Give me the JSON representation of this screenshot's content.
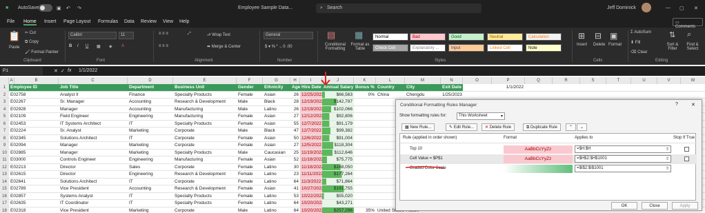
{
  "titlebar": {
    "autosave": "AutoSave",
    "doc": "Employee Sample Data...",
    "search": "Search",
    "user": "Jeff Dominick"
  },
  "menu": [
    "File",
    "Home",
    "Insert",
    "Page Layout",
    "Formulas",
    "Data",
    "Review",
    "View",
    "Help"
  ],
  "comments": "Comments",
  "ribbon": {
    "paste": "Paste",
    "cut": "Cut",
    "copy": "Copy",
    "format_painter": "Format Painter",
    "font": "Calibri",
    "size": "11",
    "wrap": "Wrap Text",
    "merge": "Merge & Center",
    "numfmt": "General",
    "cond": "Conditional Formatting",
    "fmt_table": "Format as Table",
    "styles": [
      {
        "t": "Normal",
        "bg": "#ffffff",
        "fg": "#000000"
      },
      {
        "t": "Bad",
        "bg": "#ffc7ce",
        "fg": "#9c0006"
      },
      {
        "t": "Good",
        "bg": "#c6efce",
        "fg": "#006100"
      },
      {
        "t": "Neutral",
        "bg": "#ffeb9c",
        "fg": "#9c5700"
      },
      {
        "t": "Calculation",
        "bg": "#f2f2f2",
        "fg": "#fa7d00"
      },
      {
        "t": "Check Cell",
        "bg": "#a5a5a5",
        "fg": "#ffffff"
      },
      {
        "t": "Explanatory ...",
        "bg": "#ffffff",
        "fg": "#7f7f7f"
      },
      {
        "t": "Input",
        "bg": "#ffcc99",
        "fg": "#3f3f76"
      },
      {
        "t": "Linked Cell",
        "bg": "#ffffff",
        "fg": "#fa7d00"
      },
      {
        "t": "Note",
        "bg": "#ffffcc",
        "fg": "#000000"
      }
    ],
    "insert": "Insert",
    "delete": "Delete",
    "format": "Format",
    "autosum": "AutoSum",
    "fill": "Fill",
    "clear": "Clear",
    "sort": "Sort & Filter",
    "find": "Find & Select",
    "groups": [
      "Clipboard",
      "Font",
      "Alignment",
      "Number",
      "Styles",
      "Cells",
      "Editing"
    ]
  },
  "formula_bar": {
    "cell": "P1",
    "fx": "fx",
    "value": "1/1/2022"
  },
  "columns": [
    "A",
    "B",
    "C",
    "D",
    "E",
    "F",
    "G",
    "H",
    "I",
    "J",
    "K",
    "L",
    "M",
    "N",
    "O",
    "P",
    "Q",
    "R",
    "S",
    "T",
    "U",
    "V",
    "W"
  ],
  "headers": [
    "Employee ID",
    "Job Title",
    "Department",
    "Business Unit",
    "Gender",
    "Ethnicity",
    "Age",
    "Hire Date",
    "Annual Salary",
    "Bonus %",
    "Country",
    "City",
    "Exit Date"
  ],
  "p1": "1/1/2022",
  "rows": [
    [
      "E02758",
      "Analyst II",
      "Finance",
      "Specialty Products",
      "Female",
      "Asian",
      "26",
      "12/25/2022",
      "$66,563",
      "0%",
      "China",
      "Chengdu",
      "1/25/2023"
    ],
    [
      "E02267",
      "Sr. Manager",
      "Accounting",
      "Research & Development",
      "Male",
      "Black",
      "28",
      "12/19/2022",
      "$142,797",
      "",
      "",
      "",
      ""
    ],
    [
      "E02928",
      "Manager",
      "Accounting",
      "Manufacturing",
      "Male",
      "Latino",
      "26",
      "12/19/2022",
      "$102,066",
      "",
      "",
      "",
      ""
    ],
    [
      "E02109",
      "Field Engineer",
      "Engineering",
      "Manufacturing",
      "Female",
      "Asian",
      "27",
      "12/12/2022",
      "$92,806",
      "",
      "",
      "",
      ""
    ],
    [
      "E02453",
      "IT Systems Architect",
      "IT",
      "Specialty Products",
      "Female",
      "Asian",
      "55",
      "12/7/2022",
      "$91,179",
      "",
      "",
      "",
      ""
    ],
    [
      "E02224",
      "Sr. Analyst",
      "Marketing",
      "Corporate",
      "Male",
      "Black",
      "47",
      "12/7/2022",
      "$99,382",
      "",
      "",
      "",
      ""
    ],
    [
      "E02345",
      "Solutions Architect",
      "IT",
      "Corporate",
      "Female",
      "Asian",
      "50",
      "12/6/2022",
      "$91,004",
      "",
      "",
      "",
      ""
    ],
    [
      "E02094",
      "Manager",
      "Marketing",
      "Corporate",
      "Female",
      "Asian",
      "27",
      "12/5/2022",
      "$118,304",
      "",
      "",
      "",
      ""
    ],
    [
      "E02885",
      "Manager",
      "Marketing",
      "Specialty Products",
      "Male",
      "Caucasian",
      "25",
      "11/19/2022",
      "$112,646",
      "",
      "",
      "",
      ""
    ],
    [
      "E03000",
      "Controls Engineer",
      "Engineering",
      "Manufacturing",
      "Female",
      "Asian",
      "52",
      "11/18/2022",
      "$75,775",
      "",
      "",
      "",
      ""
    ],
    [
      "E02213",
      "Director",
      "Sales",
      "Corporate",
      "Female",
      "Latino",
      "30",
      "11/18/2022",
      "$168,050",
      "",
      "",
      "",
      ""
    ],
    [
      "E02615",
      "Director",
      "Engineering",
      "Research & Development",
      "Female",
      "Latino",
      "23",
      "11/11/2022",
      "$177,264",
      "",
      "",
      "",
      ""
    ],
    [
      "E02641",
      "Solutions Architect",
      "IT",
      "Corporate",
      "Female",
      "Latino",
      "64",
      "11/3/2022",
      "$71,864",
      "",
      "",
      "",
      ""
    ],
    [
      "E02789",
      "Vice President",
      "Accounting",
      "Research & Development",
      "Female",
      "Asian",
      "41",
      "10/27/2022",
      "$191,755",
      "",
      "",
      "",
      ""
    ],
    [
      "E02857",
      "Systems Analyst",
      "IT",
      "Specialty Products",
      "Female",
      "Latino",
      "53",
      "10/22/2022",
      "$55,020",
      "",
      "",
      "",
      ""
    ],
    [
      "E02635",
      "IT Coordinator",
      "IT",
      "Specialty Products",
      "Female",
      "Latino",
      "64",
      "10/20/2022",
      "$43,271",
      "",
      "",
      "",
      ""
    ],
    [
      "E02318",
      "Vice President",
      "Marketing",
      "Corporate",
      "Male",
      "Latino",
      "64",
      "10/20/2022",
      "$257,296",
      "35%",
      "United States",
      "Austin",
      ""
    ]
  ],
  "salary_fill": [
    0.09,
    0.46,
    0.28,
    0.23,
    0.23,
    0.26,
    0.23,
    0.35,
    0.33,
    0.15,
    0.58,
    0.62,
    0.13,
    0.69,
    0.05,
    0,
    1
  ],
  "dialog": {
    "title": "Conditional Formatting Rules Manager",
    "show_label": "Show formatting rules for:",
    "show_value": "This Worksheet",
    "new_rule": "New Rule...",
    "edit_rule": "Edit Rule...",
    "delete_rule": "Delete Rule",
    "dup_rule": "Duplicate Rule",
    "col_rule": "Rule (applied in order shown)",
    "col_format": "Format",
    "col_applies": "Applies to",
    "col_stop": "Stop If True",
    "rules": [
      {
        "rule": "Top 10",
        "format": "AaBbCcYyZz",
        "applies": "=$H:$H"
      },
      {
        "rule": "Cell Value = $P$1",
        "format": "AaBbCcYyZz",
        "applies": "=$H$2:$H$1001"
      },
      {
        "rule": "Graded Color Scale",
        "format": "",
        "applies": "=$I$2:$I$1001"
      }
    ],
    "ok": "OK",
    "close": "Close",
    "apply": "Apply"
  }
}
